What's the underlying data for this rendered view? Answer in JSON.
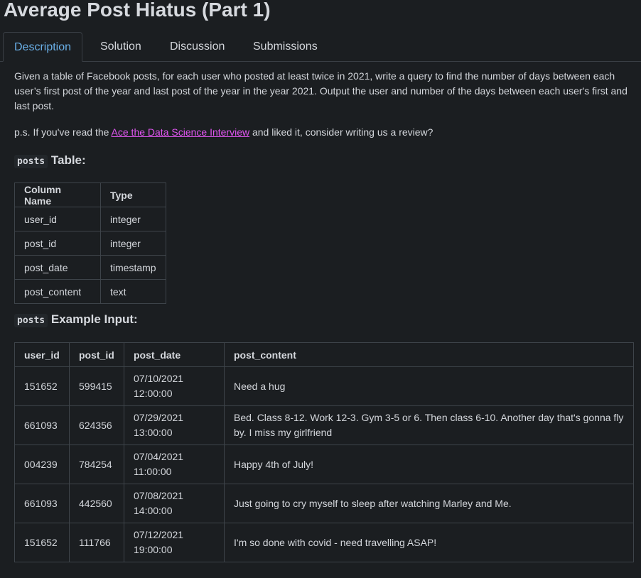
{
  "page": {
    "title": "Average Post Hiatus (Part 1)"
  },
  "tabs": [
    {
      "label": "Description",
      "active": true
    },
    {
      "label": "Solution",
      "active": false
    },
    {
      "label": "Discussion",
      "active": false
    },
    {
      "label": "Submissions",
      "active": false
    }
  ],
  "description": {
    "text": "Given a table of Facebook posts, for each user who posted at least twice in 2021, write a query to find the number of days between each user’s first post of the year and last post of the year in the year 2021. Output the user and number of the days between each user's first and last post.",
    "ps_prefix": "p.s. If you've read the ",
    "ps_link": "Ace the Data Science Interview",
    "ps_suffix": " and liked it, consider writing us a review?"
  },
  "schema": {
    "table_name": "posts",
    "heading_suffix": "Table:",
    "headers": [
      "Column Name",
      "Type"
    ],
    "rows": [
      [
        "user_id",
        "integer"
      ],
      [
        "post_id",
        "integer"
      ],
      [
        "post_date",
        "timestamp"
      ],
      [
        "post_content",
        "text"
      ]
    ]
  },
  "example": {
    "table_name": "posts",
    "heading_suffix": "Example Input:",
    "headers": [
      "user_id",
      "post_id",
      "post_date",
      "post_content"
    ],
    "rows": [
      [
        "151652",
        "599415",
        "07/10/2021 12:00:00",
        "Need a hug"
      ],
      [
        "661093",
        "624356",
        "07/29/2021 13:00:00",
        "Bed. Class 8-12. Work 12-3. Gym 3-5 or 6. Then class 6-10. Another day that's gonna fly by. I miss my girlfriend"
      ],
      [
        "004239",
        "784254",
        "07/04/2021 11:00:00",
        "Happy 4th of July!"
      ],
      [
        "661093",
        "442560",
        "07/08/2021 14:00:00",
        "Just going to cry myself to sleep after watching Marley and Me."
      ],
      [
        "151652",
        "111766",
        "07/12/2021 19:00:00",
        "I'm so done with covid - need travelling ASAP!"
      ]
    ]
  }
}
